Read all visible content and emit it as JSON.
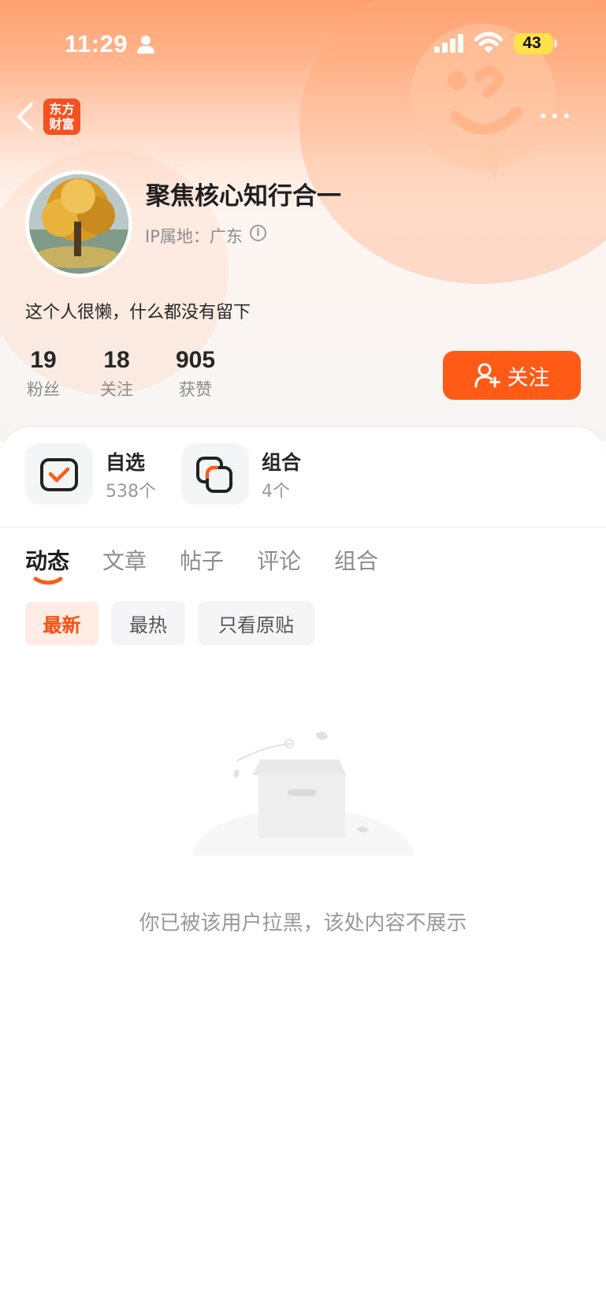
{
  "status_bar": {
    "time": "11:29",
    "battery": "43",
    "battery_color": "#ffe14a"
  },
  "nav": {
    "back_icon": "chevron-left-icon",
    "app_logo_line1": "东方",
    "app_logo_line2": "财富",
    "more_icon": "more-horizontal-icon"
  },
  "profile": {
    "username": "聚焦核心知行合一",
    "ip_location": "IP属地：广东",
    "bio": "这个人很懒，什么都没有留下",
    "stats": [
      {
        "value": "19",
        "label": "粉丝"
      },
      {
        "value": "18",
        "label": "关注"
      },
      {
        "value": "905",
        "label": "获赞"
      }
    ],
    "follow_button": "关注",
    "accent_color": "#ff5a16"
  },
  "shortcuts": [
    {
      "title": "自选",
      "count": "538个",
      "icon": "watchlist-check-icon"
    },
    {
      "title": "组合",
      "count": "4个",
      "icon": "portfolio-icon"
    }
  ],
  "tabs": [
    "动态",
    "文章",
    "帖子",
    "评论",
    "组合"
  ],
  "active_tab": "动态",
  "filters": [
    "最新",
    "最热",
    "只看原贴"
  ],
  "active_filter": "最新",
  "empty_state": {
    "icon": "empty-box-icon",
    "message": "你已被该用户拉黑，该处内容不展示"
  }
}
